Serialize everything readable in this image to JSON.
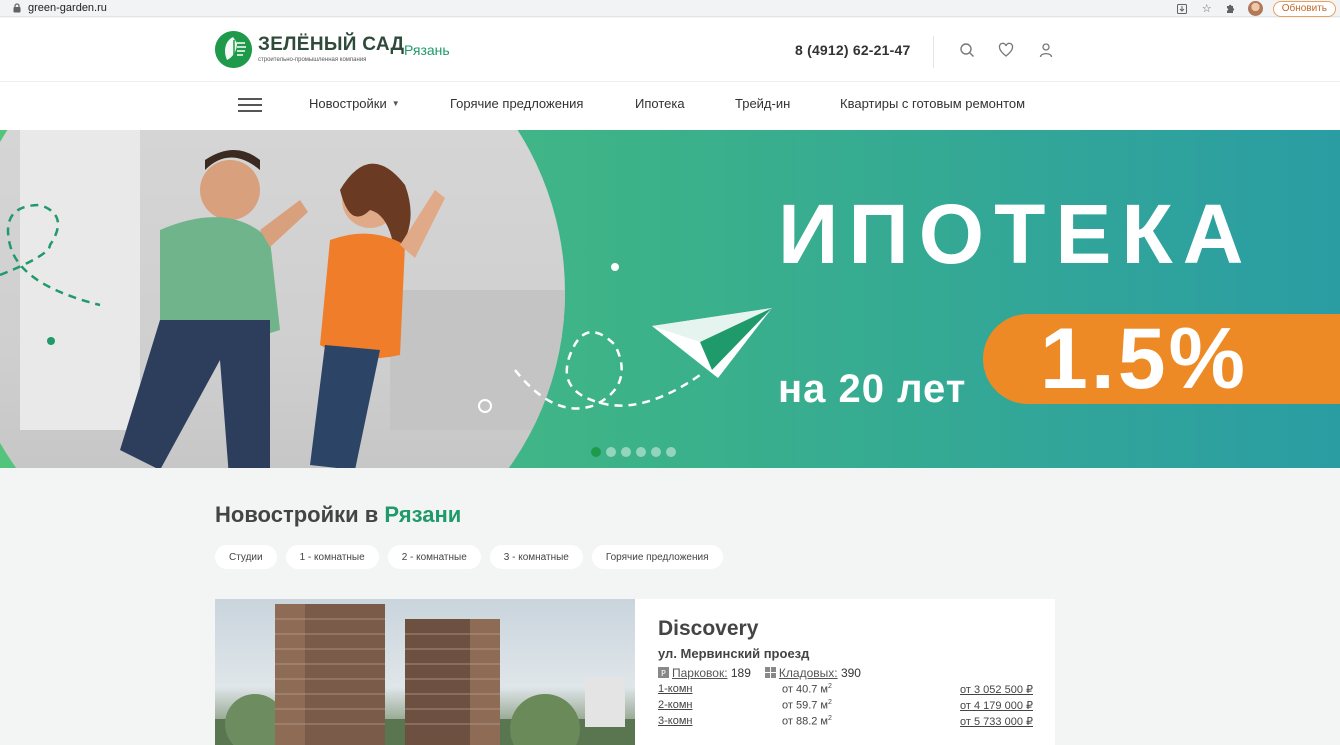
{
  "browser": {
    "url": "green-garden.ru",
    "update_label": "Обновить"
  },
  "header": {
    "logo_title": "ЗЕЛЁНЫЙ САД",
    "logo_subtitle": "строительно-промышленная компания",
    "city": "Рязань",
    "phone": "8 (4912) 62-21-47"
  },
  "nav": {
    "items": [
      {
        "label": "Новостройки",
        "has_dropdown": true
      },
      {
        "label": "Горячие предложения"
      },
      {
        "label": "Ипотека"
      },
      {
        "label": "Трейд-ин"
      },
      {
        "label": "Квартиры с готовым ремонтом"
      }
    ]
  },
  "hero": {
    "title": "ИПОТЕКА",
    "rate": "1.5%",
    "term": "на 20 лет",
    "slides_count": 6,
    "active_slide": 1
  },
  "section": {
    "title_prefix": "Новостройки в",
    "title_city": "Рязани",
    "filters": [
      "Студии",
      "1 - комнатные",
      "2 - комнатные",
      "3 - комнатные",
      "Горячие предложения"
    ]
  },
  "project": {
    "name": "Discovery",
    "address": "ул. Мервинский проезд",
    "parking_label": "Парковок:",
    "parking_count": "189",
    "storage_label": "Кладовых:",
    "storage_count": "390",
    "apartments": [
      {
        "type": "1-комн",
        "area_prefix": "от 40.7 м",
        "price": "от 3 052 500 ₽"
      },
      {
        "type": "2-комн",
        "area_prefix": "от 59.7 м",
        "price": "от 4 179 000 ₽"
      },
      {
        "type": "3-комн",
        "area_prefix": "от 88.2 м",
        "price": "от 5 733 000 ₽"
      }
    ]
  },
  "colors": {
    "brand_green": "#1f9a4a",
    "accent_teal": "#1f9a6a",
    "orange": "#ee8a25"
  }
}
